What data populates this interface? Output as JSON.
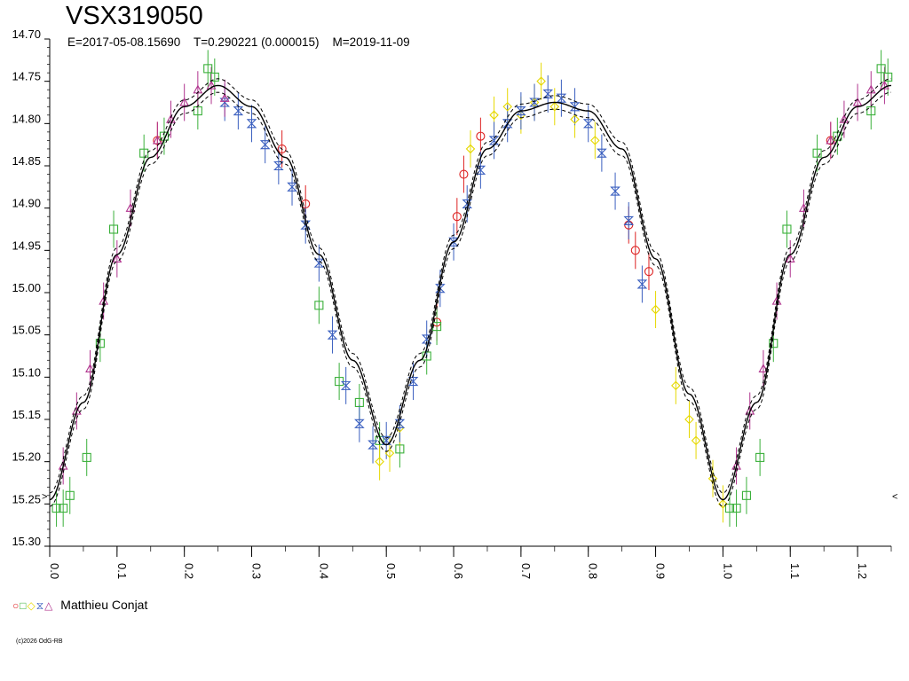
{
  "chart_data": {
    "type": "scatter",
    "title": "VSX319050",
    "subtitle": "E=2017-05-08.15690    T=0.290221 (0.000015)    M=2019-11-09",
    "xlabel": "",
    "ylabel": "",
    "xlim": [
      0.0,
      1.25
    ],
    "ylim": [
      15.3,
      14.7
    ],
    "y_reversed": true,
    "grid": false,
    "x_ticks": [
      "0.0",
      "0.1",
      "0.2",
      "0.3",
      "0.4",
      "0.5",
      "0.6",
      "0.7",
      "0.8",
      "0.9",
      "1.0",
      "1.1",
      "1.2"
    ],
    "y_ticks": [
      "14.70",
      "14.75",
      "14.80",
      "14.85",
      "14.90",
      "14.95",
      "15.00",
      "15.05",
      "15.10",
      "15.15",
      "15.20",
      "15.25",
      "15.30"
    ],
    "edge_markers": {
      "left": ">",
      "right": "<"
    },
    "fit_curve": {
      "name": "",
      "phase": [
        0.0,
        0.05,
        0.1,
        0.15,
        0.2,
        0.25,
        0.3,
        0.35,
        0.4,
        0.45,
        0.5,
        0.55,
        0.6,
        0.65,
        0.7,
        0.75,
        0.8,
        0.85,
        0.9,
        0.95,
        1.0,
        1.05,
        1.1,
        1.15,
        1.2,
        1.25
      ],
      "mag": [
        15.245,
        15.13,
        14.955,
        14.84,
        14.78,
        14.755,
        14.78,
        14.84,
        14.955,
        15.08,
        15.18,
        15.08,
        14.94,
        14.83,
        14.785,
        14.775,
        14.785,
        14.83,
        14.96,
        15.12,
        15.245,
        15.13,
        14.955,
        14.84,
        14.78,
        14.755
      ],
      "band": 0.008
    },
    "series": [
      {
        "name": "Matthieu Conjat",
        "symbol": "circle",
        "color": "#dd2222",
        "x": [
          0.16,
          0.345,
          0.38,
          0.575,
          0.605,
          0.615,
          0.64,
          0.86,
          0.87,
          0.89,
          1.16
        ],
        "y": [
          14.82,
          14.83,
          14.895,
          15.035,
          14.91,
          14.86,
          14.815,
          14.92,
          14.95,
          14.975,
          14.82
        ]
      },
      {
        "name": "Matthieu Conjat",
        "symbol": "square",
        "color": "#3ab03a",
        "x": [
          0.01,
          0.02,
          0.03,
          0.055,
          0.075,
          0.095,
          0.14,
          0.17,
          0.22,
          0.235,
          0.245,
          0.4,
          0.43,
          0.46,
          0.49,
          0.52,
          0.56,
          0.575,
          1.01,
          1.02,
          1.035,
          1.055,
          1.075,
          1.095,
          1.14,
          1.17,
          1.22,
          1.235,
          1.245
        ],
        "y": [
          15.255,
          15.255,
          15.24,
          15.195,
          15.06,
          14.925,
          14.835,
          14.815,
          14.785,
          14.735,
          14.745,
          15.015,
          15.105,
          15.13,
          15.175,
          15.185,
          15.075,
          15.04,
          15.255,
          15.255,
          15.24,
          15.195,
          15.06,
          14.925,
          14.835,
          14.815,
          14.785,
          14.735,
          14.745
        ]
      },
      {
        "name": "Matthieu Conjat",
        "symbol": "diamond",
        "color": "#e6d800",
        "x": [
          0.49,
          0.505,
          0.52,
          0.625,
          0.66,
          0.68,
          0.7,
          0.72,
          0.73,
          0.75,
          0.78,
          0.81,
          0.9,
          0.93,
          0.95,
          0.96,
          0.985,
          1.0
        ],
        "y": [
          15.2,
          15.19,
          15.16,
          14.83,
          14.79,
          14.78,
          14.79,
          14.775,
          14.75,
          14.78,
          14.795,
          14.82,
          15.02,
          15.11,
          15.15,
          15.175,
          15.22,
          15.25
        ]
      },
      {
        "name": "Matthieu Conjat",
        "symbol": "hourglass",
        "color": "#3a5fbf",
        "x": [
          0.26,
          0.28,
          0.3,
          0.32,
          0.34,
          0.36,
          0.38,
          0.4,
          0.42,
          0.44,
          0.46,
          0.48,
          0.5,
          0.52,
          0.54,
          0.56,
          0.58,
          0.6,
          0.62,
          0.64,
          0.66,
          0.68,
          0.7,
          0.72,
          0.74,
          0.76,
          0.78,
          0.8,
          0.82,
          0.84,
          0.86,
          0.88
        ],
        "y": [
          14.775,
          14.785,
          14.8,
          14.825,
          14.85,
          14.875,
          14.92,
          14.965,
          15.05,
          15.11,
          15.155,
          15.18,
          15.175,
          15.155,
          15.105,
          15.055,
          14.995,
          14.94,
          14.895,
          14.855,
          14.82,
          14.8,
          14.785,
          14.775,
          14.765,
          14.77,
          14.78,
          14.8,
          14.835,
          14.88,
          14.915,
          14.99
        ]
      },
      {
        "name": "Matthieu Conjat",
        "symbol": "triangle",
        "color": "#b0348e",
        "x": [
          0.02,
          0.04,
          0.06,
          0.08,
          0.1,
          0.12,
          0.16,
          0.18,
          0.2,
          0.22,
          0.24,
          0.26,
          1.02,
          1.04,
          1.06,
          1.08,
          1.1,
          1.12,
          1.16,
          1.18,
          1.2,
          1.22,
          1.24
        ],
        "y": [
          15.205,
          15.14,
          15.09,
          15.01,
          14.96,
          14.9,
          14.82,
          14.795,
          14.775,
          14.76,
          14.755,
          14.77,
          15.205,
          15.14,
          15.09,
          15.01,
          14.96,
          14.9,
          14.82,
          14.795,
          14.775,
          14.76,
          14.755
        ]
      }
    ],
    "error_bar": 0.022,
    "legend": {
      "placement": "bottom-left",
      "symbols": [
        "○",
        "□",
        "◇",
        "⧖",
        "△"
      ],
      "label": "Matthieu Conjat"
    },
    "copyright": "(c)2026 OdG-RB"
  }
}
